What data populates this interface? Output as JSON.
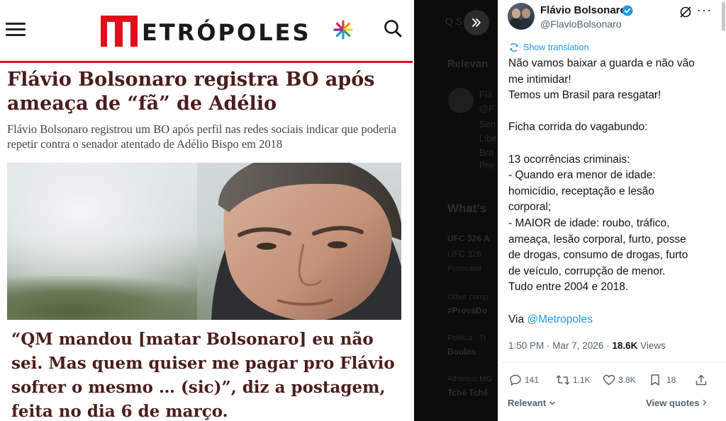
{
  "article": {
    "brand": "ETRÓPOLES",
    "headline": "Flávio Bolsonaro registra BO após ameaça de “fã” de Adélio",
    "subhead": "Flávio Bolsonaro registrou um BO após perfil nas redes sociais indicar que poderia repetir contra o senador atentado de Adélio Bispo em 2018",
    "quote": "“QM mandou [matar Bolsonaro] eu não sei. Mas quem quiser me pagar pro Flávio sofrer o mesmo … (sic)”, diz a postagem, feita no dia 6 de março.",
    "accent": "#e10e1d",
    "headline_color": "#4a1d1d"
  },
  "mid": {
    "search_fragment": "Q S",
    "fragments": [
      "Relevan",
      "Flá",
      "@F",
      "Sen",
      "Libe",
      "Bra",
      "Pre",
      "What’s",
      "UFC 326 A",
      "UFC 326",
      "Promoted",
      "Other comp",
      "#ProvaDo",
      "Politica · Tr",
      "Boulos",
      "Athletico MG",
      "Tchê Tchê"
    ]
  },
  "tweet": {
    "name": "Flávio Bolsonaro",
    "handle": "@FlavioBolsonaro",
    "show_translation": "Show translation",
    "lines": [
      "Não vamos baixar a guarda e não vão",
      "me intimidar!",
      "Temos um Brasil para resgatar!",
      "",
      "Ficha corrida do vagabundo:",
      "",
      "13 ocorrências criminais:",
      "- Quando era menor de idade:",
      "homicídio, receptação e lesão",
      "corporal;",
      "- MAIOR de idade: roubo, tráfico,",
      "ameaça, lesão corporal, furto, posse",
      "de drogas, consumo de drogas, furto",
      "de veículo, corrupção de menor.",
      "Tudo entre 2004 e 2018.",
      ""
    ],
    "via_prefix": "Via ",
    "via_link": "@Metropoles",
    "time": "1:50 PM · Mar 7, 2026 · ",
    "views_count": "18.6K",
    "views_label": " Views",
    "replies": "141",
    "reposts": "1.1K",
    "likes": "3.8K",
    "bookmarks": "18",
    "relevant_label": "Relevant",
    "view_quotes_label": "View quotes",
    "link_color": "#1d9bf0"
  }
}
